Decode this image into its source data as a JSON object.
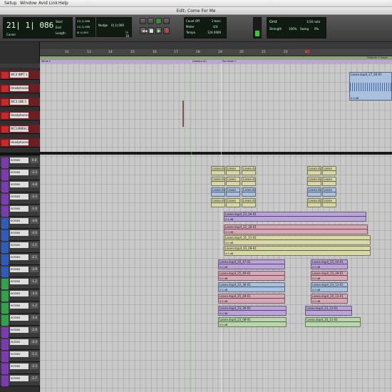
{
  "menu": [
    "Setup",
    "Window",
    "Avid Link",
    "Help"
  ],
  "window_title": "Edit: Come For Me",
  "transport": {
    "counter": "21| 1| 086",
    "counter_suffix": "-",
    "cursor_label": "Cursor",
    "start_label": "Start",
    "end_label": "End",
    "length_label": "Length",
    "start_value": "21| 1| 086",
    "end_value": "21| 1| 086",
    "length_value": "0| 0| 000",
    "nudge_label": "Nudge",
    "nudge_value": "0| 1| 000",
    "count_off_label": "Count Off",
    "meter_label": "Meter",
    "meter_value": "4/4",
    "tempo_label": "Tempo",
    "tempo_value": "124.0000",
    "count_off_value": "2 bars",
    "grid_label": "Grid",
    "grid_value": "1/16 note",
    "strength_label": "Strength",
    "strength_value": "100%",
    "swing_label": "Swing",
    "swing_value": "0%",
    "zoom_value": "½ 16"
  },
  "ruler": {
    "bars": [
      "12",
      "13",
      "14",
      "15",
      "16",
      "17",
      "18",
      "19",
      "20",
      "21",
      "22",
      "23"
    ],
    "key_label": "Default: C major",
    "markers": [
      "Verse 1",
      "Leaders #1",
      "Pre-Hook 1"
    ]
  },
  "tracks_top": [
    {
      "name": "WC3 INPT 1",
      "color": "#c8292b"
    },
    {
      "name": "Headphones",
      "color": "#c8292b"
    },
    {
      "name": "WC3 LNE 1",
      "color": "#c8292b"
    },
    {
      "name": "Headphones",
      "color": "#c8292b"
    },
    {
      "name": "MC3.M6RH.1",
      "color": "#c8292b"
    },
    {
      "name": "Headphones",
      "color": "#c8292b"
    }
  ],
  "tracks_bottom": [
    {
      "name": "ecroes",
      "vol": "0.0",
      "color": "#7d3ab6"
    },
    {
      "name": "ecroes",
      "vol": "-2.3",
      "color": "#7d3ab6"
    },
    {
      "name": "ecroes",
      "vol": "-4.8",
      "color": "#7d3ab6"
    },
    {
      "name": "ecroes",
      "vol": "-2.3",
      "color": "#7d3ab6"
    },
    {
      "name": "ecroes",
      "vol": "-1.0",
      "color": "#7d3ab6"
    },
    {
      "name": "ecroes",
      "vol": "-4.6",
      "color": "#2d5bbf"
    },
    {
      "name": "ecroes",
      "vol": "-4.0",
      "color": "#2d5bbf"
    },
    {
      "name": "ecroes",
      "vol": "-1.5",
      "color": "#2d5bbf"
    },
    {
      "name": "ecroes",
      "vol": "-2.1",
      "color": "#2d5bbf"
    },
    {
      "name": "ecroes",
      "vol": "-3.9",
      "color": "#2d5bbf"
    },
    {
      "name": "ecroes",
      "vol": "-1.2",
      "color": "#2fa34a"
    },
    {
      "name": "ecroes",
      "vol": "-3.4",
      "color": "#2fa34a"
    },
    {
      "name": "ecroes",
      "vol": "-1.2",
      "color": "#2fa34a"
    },
    {
      "name": "ecroes",
      "vol": "-3.4",
      "color": "#2fa34a"
    },
    {
      "name": "ecroes",
      "vol": "-2.9",
      "color": "#7d3ab6"
    },
    {
      "name": "ecroes",
      "vol": "-2.0",
      "color": "#7d3ab6"
    },
    {
      "name": "ecroes",
      "vol": "-1.2",
      "color": "#7d3ab6"
    },
    {
      "name": "ecroes",
      "vol": "-2.3",
      "color": "#7d3ab6"
    },
    {
      "name": "ecroes",
      "vol": "-2.7",
      "color": "#7d3ab6"
    }
  ],
  "clips": {
    "top_clip": {
      "label": "Lasea.dup4_27_04-01",
      "vol": "0.0 dB"
    },
    "small_labels": [
      "Lasea.dup",
      "Lasea",
      "Lasea.dup"
    ],
    "wide_labels": [
      {
        "label": "Lasea.dup4_23_04-01",
        "vol": "0.0 dB"
      },
      {
        "label": "Lasea.dup4_22_36-01",
        "vol": "0.0 dB"
      },
      {
        "label": "Lasea.dup4_31_11-01",
        "vol": "0.0 dB"
      },
      {
        "label": "Lasea.dup4_03_09-01",
        "vol": "0.0 dB"
      },
      {
        "label": "Lasea.dup4_25_47-01",
        "vol": "0.0 dB"
      },
      {
        "label": "Lasea.dup4_25_49-01",
        "vol": "0.0 dB"
      },
      {
        "label": "Lasea.dup4_22_36-01",
        "vol": "0.0 dB"
      },
      {
        "label": "Lasea.dup4_25_49-01",
        "vol": "0.0 dB"
      },
      {
        "label": "Lasea.dup4_23_30-01",
        "vol": "0.0 dB"
      },
      {
        "label": "Lasea.dup4_23_08-01",
        "vol": "0.0 dB"
      },
      {
        "label": "Lasea.dup4_25_04-01",
        "vol": "0.0 dB"
      },
      {
        "label": "Lasea.dup4_25_49-01",
        "vol": "0.0 dB"
      },
      {
        "label": "Lasea.dup4_23_13-01",
        "vol": "0.0 dB"
      },
      {
        "label": "Lasea.dup4_20_11-01",
        "vol": "0.0 dB"
      }
    ]
  }
}
